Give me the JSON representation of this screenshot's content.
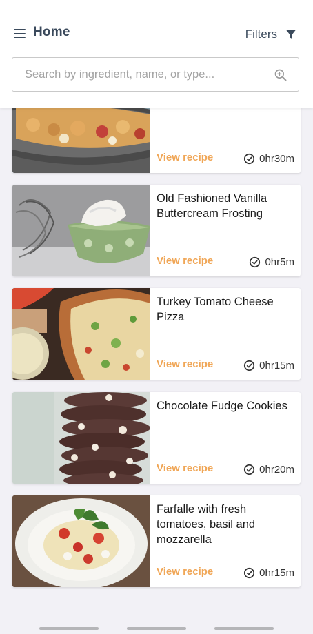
{
  "header": {
    "title": "Home",
    "filters_label": "Filters"
  },
  "search": {
    "placeholder": "Search by ingredient, name, or type...",
    "value": ""
  },
  "colors": {
    "accent": "#f0a656",
    "header_text": "#3b4a5c",
    "background": "#f2f1f6"
  },
  "recipes": [
    {
      "title": "",
      "link_label": "View recipe",
      "time": "0hr30m"
    },
    {
      "title": "Old Fashioned Vanilla Buttercream Frosting",
      "link_label": "View recipe",
      "time": "0hr5m"
    },
    {
      "title": "Turkey Tomato Cheese Pizza",
      "link_label": "View recipe",
      "time": "0hr15m"
    },
    {
      "title": "Chocolate Fudge Cookies",
      "link_label": "View recipe",
      "time": "0hr20m"
    },
    {
      "title": "Farfalle with fresh tomatoes, basil and mozzarella",
      "link_label": "View recipe",
      "time": "0hr15m"
    }
  ],
  "icons": {
    "menu": "hamburger-menu-icon",
    "filter": "funnel-filter-icon",
    "search": "zoom-in-search-icon",
    "clock": "clock-icon"
  }
}
